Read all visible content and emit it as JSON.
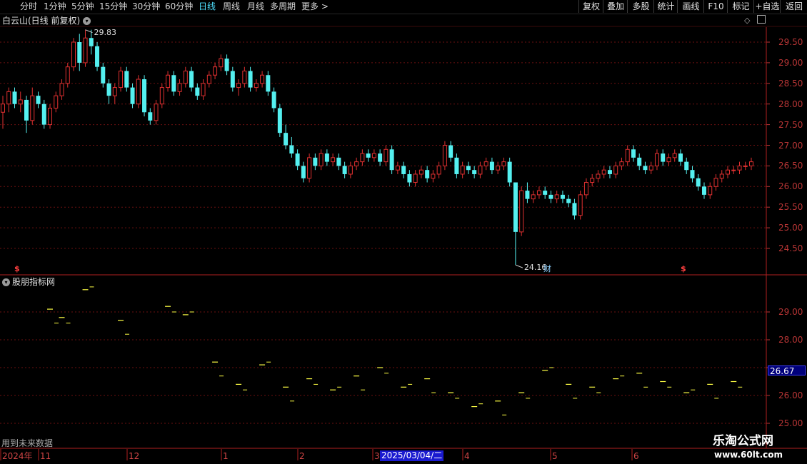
{
  "toolbar": {
    "periods": [
      "分时",
      "1分钟",
      "5分钟",
      "15分钟",
      "30分钟",
      "60分钟",
      "日线",
      "周线",
      "月线",
      "多周期",
      "更多 >"
    ],
    "active_period": "日线",
    "right_buttons": [
      "复权",
      "叠加",
      "多股",
      "统计",
      "画线",
      "F10",
      "标记",
      "+自选",
      "返回"
    ]
  },
  "main_panel": {
    "title": "白云山(日线 前复权)",
    "y_ticks": [
      "29.50",
      "29.00",
      "28.50",
      "28.00",
      "27.50",
      "27.00",
      "26.50",
      "26.00",
      "25.50",
      "25.00",
      "24.50"
    ],
    "high_label": "29.83",
    "low_label": "24.16",
    "markers": [
      "$",
      "财",
      "$"
    ]
  },
  "sub_panel": {
    "title": "股朋指标网",
    "y_ticks": [
      "29.00",
      "28.00",
      "26.00",
      "25.00"
    ],
    "price_tag": "26.67",
    "note": "用到未来数据"
  },
  "x_axis": {
    "labels": [
      "2024年",
      "11",
      "12",
      "1",
      "2",
      "3",
      "4",
      "5",
      "6"
    ],
    "cursor_date": "2025/03/04/二"
  },
  "watermark": {
    "name": "乐淘公式网",
    "url": "www.60lt.com"
  },
  "colors": {
    "up": "#e03030",
    "down": "#54f0f0",
    "grid": "#6b1010",
    "active": "#4fe0ff",
    "indicator": "#ffff44"
  },
  "chart_data": {
    "type": "candlestick",
    "ylim": [
      24.0,
      30.0
    ],
    "sub_ylim": [
      24.6,
      30.0
    ],
    "ohlc": [
      [
        27.8,
        28.2,
        27.4,
        28.0
      ],
      [
        28.0,
        28.4,
        27.8,
        28.3
      ],
      [
        28.3,
        28.4,
        27.9,
        28.0
      ],
      [
        28.0,
        28.3,
        27.8,
        28.1
      ],
      [
        28.1,
        28.2,
        27.3,
        27.6
      ],
      [
        27.6,
        28.4,
        27.5,
        28.2
      ],
      [
        28.2,
        28.3,
        27.9,
        28.0
      ],
      [
        28.0,
        28.1,
        27.4,
        27.5
      ],
      [
        27.5,
        28.0,
        27.4,
        27.9
      ],
      [
        27.9,
        28.3,
        27.8,
        28.2
      ],
      [
        28.2,
        28.6,
        28.1,
        28.5
      ],
      [
        28.5,
        29.0,
        28.4,
        28.9
      ],
      [
        28.9,
        29.6,
        28.8,
        29.5
      ],
      [
        29.5,
        29.7,
        28.8,
        29.0
      ],
      [
        29.0,
        29.8,
        28.9,
        29.6
      ],
      [
        29.6,
        29.8,
        29.2,
        29.4
      ],
      [
        29.4,
        29.5,
        28.8,
        28.9
      ],
      [
        28.9,
        29.0,
        28.4,
        28.5
      ],
      [
        28.5,
        28.6,
        28.0,
        28.2
      ],
      [
        28.2,
        28.5,
        28.0,
        28.4
      ],
      [
        28.4,
        28.9,
        28.3,
        28.8
      ],
      [
        28.8,
        28.9,
        28.3,
        28.4
      ],
      [
        28.4,
        28.5,
        27.9,
        28.0
      ],
      [
        28.0,
        28.7,
        27.9,
        28.6
      ],
      [
        28.6,
        28.7,
        27.7,
        27.8
      ],
      [
        27.8,
        27.9,
        27.5,
        27.6
      ],
      [
        27.6,
        28.1,
        27.5,
        28.0
      ],
      [
        28.0,
        28.5,
        27.9,
        28.4
      ],
      [
        28.4,
        28.8,
        28.3,
        28.7
      ],
      [
        28.7,
        28.8,
        28.2,
        28.3
      ],
      [
        28.3,
        28.6,
        28.2,
        28.5
      ],
      [
        28.5,
        28.9,
        28.4,
        28.8
      ],
      [
        28.8,
        28.9,
        28.3,
        28.4
      ],
      [
        28.4,
        28.5,
        28.1,
        28.2
      ],
      [
        28.2,
        28.6,
        28.1,
        28.5
      ],
      [
        28.5,
        28.8,
        28.4,
        28.7
      ],
      [
        28.7,
        29.0,
        28.6,
        28.9
      ],
      [
        28.9,
        29.2,
        28.8,
        29.1
      ],
      [
        29.1,
        29.2,
        28.7,
        28.8
      ],
      [
        28.8,
        28.9,
        28.3,
        28.4
      ],
      [
        28.4,
        28.6,
        28.2,
        28.5
      ],
      [
        28.5,
        28.9,
        28.4,
        28.8
      ],
      [
        28.8,
        28.9,
        28.3,
        28.4
      ],
      [
        28.4,
        28.6,
        28.3,
        28.5
      ],
      [
        28.5,
        28.8,
        28.4,
        28.7
      ],
      [
        28.7,
        28.8,
        28.2,
        28.3
      ],
      [
        28.3,
        28.4,
        27.8,
        27.9
      ],
      [
        27.9,
        28.0,
        27.2,
        27.3
      ],
      [
        27.3,
        27.5,
        26.9,
        27.0
      ],
      [
        27.0,
        27.2,
        26.7,
        26.8
      ],
      [
        26.8,
        26.9,
        26.4,
        26.5
      ],
      [
        26.5,
        26.6,
        26.1,
        26.2
      ],
      [
        26.2,
        26.8,
        26.1,
        26.7
      ],
      [
        26.7,
        26.8,
        26.4,
        26.5
      ],
      [
        26.5,
        26.9,
        26.4,
        26.8
      ],
      [
        26.8,
        26.9,
        26.5,
        26.6
      ],
      [
        26.6,
        26.8,
        26.5,
        26.7
      ],
      [
        26.7,
        26.8,
        26.4,
        26.5
      ],
      [
        26.5,
        26.6,
        26.2,
        26.3
      ],
      [
        26.3,
        26.6,
        26.2,
        26.5
      ],
      [
        26.5,
        26.7,
        26.4,
        26.6
      ],
      [
        26.6,
        26.9,
        26.5,
        26.8
      ],
      [
        26.8,
        26.9,
        26.6,
        26.7
      ],
      [
        26.7,
        26.9,
        26.6,
        26.8
      ],
      [
        26.8,
        26.9,
        26.5,
        26.6
      ],
      [
        26.6,
        27.0,
        26.5,
        26.9
      ],
      [
        26.9,
        27.0,
        26.3,
        26.4
      ],
      [
        26.4,
        26.6,
        26.3,
        26.5
      ],
      [
        26.5,
        26.6,
        26.2,
        26.3
      ],
      [
        26.3,
        26.4,
        26.0,
        26.1
      ],
      [
        26.1,
        26.4,
        26.0,
        26.3
      ],
      [
        26.3,
        26.5,
        26.2,
        26.4
      ],
      [
        26.4,
        26.5,
        26.1,
        26.2
      ],
      [
        26.2,
        26.4,
        26.1,
        26.3
      ],
      [
        26.3,
        26.6,
        26.2,
        26.5
      ],
      [
        26.5,
        27.1,
        26.4,
        27.0
      ],
      [
        27.0,
        27.1,
        26.6,
        26.7
      ],
      [
        26.7,
        26.8,
        26.2,
        26.3
      ],
      [
        26.3,
        26.6,
        26.2,
        26.5
      ],
      [
        26.5,
        26.6,
        26.3,
        26.4
      ],
      [
        26.4,
        26.5,
        26.2,
        26.3
      ],
      [
        26.3,
        26.6,
        26.2,
        26.5
      ],
      [
        26.5,
        26.7,
        26.4,
        26.6
      ],
      [
        26.6,
        26.7,
        26.3,
        26.4
      ],
      [
        26.4,
        26.6,
        26.3,
        26.5
      ],
      [
        26.5,
        26.7,
        26.4,
        26.6
      ],
      [
        26.6,
        26.7,
        26.0,
        26.1
      ],
      [
        26.1,
        24.9,
        24.1,
        24.9
      ],
      [
        24.9,
        26.0,
        24.8,
        25.9
      ],
      [
        25.9,
        26.1,
        25.6,
        25.7
      ],
      [
        25.7,
        25.9,
        25.6,
        25.8
      ],
      [
        25.8,
        26.0,
        25.7,
        25.9
      ],
      [
        25.9,
        26.0,
        25.7,
        25.8
      ],
      [
        25.8,
        25.9,
        25.6,
        25.7
      ],
      [
        25.7,
        25.9,
        25.6,
        25.8
      ],
      [
        25.8,
        25.9,
        25.6,
        25.7
      ],
      [
        25.7,
        25.8,
        25.5,
        25.6
      ],
      [
        25.6,
        25.7,
        25.2,
        25.3
      ],
      [
        25.3,
        25.9,
        25.2,
        25.8
      ],
      [
        25.8,
        26.2,
        25.7,
        26.1
      ],
      [
        26.1,
        26.3,
        26.0,
        26.2
      ],
      [
        26.2,
        26.4,
        26.1,
        26.3
      ],
      [
        26.3,
        26.5,
        26.2,
        26.4
      ],
      [
        26.4,
        26.5,
        26.2,
        26.3
      ],
      [
        26.3,
        26.6,
        26.2,
        26.5
      ],
      [
        26.5,
        26.7,
        26.4,
        26.6
      ],
      [
        26.6,
        27.0,
        26.5,
        26.9
      ],
      [
        26.9,
        27.0,
        26.6,
        26.7
      ],
      [
        26.7,
        26.8,
        26.4,
        26.5
      ],
      [
        26.5,
        26.6,
        26.3,
        26.4
      ],
      [
        26.4,
        26.6,
        26.3,
        26.5
      ],
      [
        26.5,
        26.9,
        26.4,
        26.8
      ],
      [
        26.8,
        26.9,
        26.5,
        26.6
      ],
      [
        26.6,
        26.8,
        26.5,
        26.7
      ],
      [
        26.7,
        26.9,
        26.6,
        26.8
      ],
      [
        26.8,
        26.9,
        26.5,
        26.6
      ],
      [
        26.6,
        26.7,
        26.3,
        26.4
      ],
      [
        26.4,
        26.5,
        26.1,
        26.2
      ],
      [
        26.2,
        26.3,
        25.9,
        26.0
      ],
      [
        26.0,
        26.1,
        25.7,
        25.8
      ],
      [
        25.8,
        26.1,
        25.7,
        26.0
      ],
      [
        26.0,
        26.3,
        25.9,
        26.2
      ],
      [
        26.2,
        26.4,
        26.1,
        26.3
      ],
      [
        26.3,
        26.5,
        26.2,
        26.4
      ],
      [
        26.4,
        26.5,
        26.3,
        26.4
      ],
      [
        26.4,
        26.6,
        26.3,
        26.5
      ],
      [
        26.5,
        26.6,
        26.4,
        26.5
      ],
      [
        26.5,
        26.7,
        26.4,
        26.6
      ]
    ],
    "indicator_segments": [
      [
        8,
        29.1
      ],
      [
        10,
        28.8
      ],
      [
        14,
        29.8
      ],
      [
        20,
        28.7
      ],
      [
        28,
        29.2
      ],
      [
        31,
        28.9
      ],
      [
        36,
        27.2
      ],
      [
        40,
        26.4
      ],
      [
        44,
        27.1
      ],
      [
        48,
        26.3
      ],
      [
        52,
        26.6
      ],
      [
        56,
        26.2
      ],
      [
        60,
        26.7
      ],
      [
        64,
        27.0
      ],
      [
        68,
        26.3
      ],
      [
        72,
        26.6
      ],
      [
        76,
        26.1
      ],
      [
        80,
        25.6
      ],
      [
        84,
        25.8
      ],
      [
        88,
        26.1
      ],
      [
        92,
        26.9
      ],
      [
        96,
        26.4
      ],
      [
        100,
        26.3
      ],
      [
        104,
        26.6
      ],
      [
        108,
        26.8
      ],
      [
        112,
        26.5
      ],
      [
        116,
        26.1
      ],
      [
        120,
        26.4
      ],
      [
        124,
        26.5
      ]
    ]
  }
}
